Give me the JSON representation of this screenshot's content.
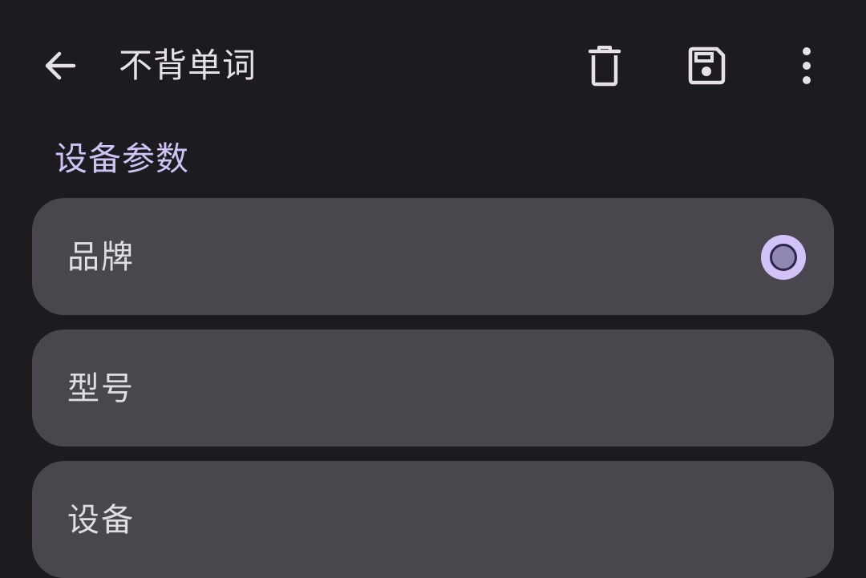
{
  "appbar": {
    "back_icon": "arrow-left-icon",
    "title": "不背单词",
    "actions": [
      {
        "icon": "trash-icon"
      },
      {
        "icon": "save-icon"
      },
      {
        "icon": "more-vert-icon"
      }
    ]
  },
  "section": {
    "title": "设备参数"
  },
  "fields": [
    {
      "label": "品牌",
      "radio_selected": true
    },
    {
      "label": "型号"
    },
    {
      "label": "设备"
    }
  ],
  "colors": {
    "background": "#1c1b1f",
    "surface": "#49474d",
    "accent": "#cfc2f5",
    "on_surface": "#e6e1e5"
  }
}
